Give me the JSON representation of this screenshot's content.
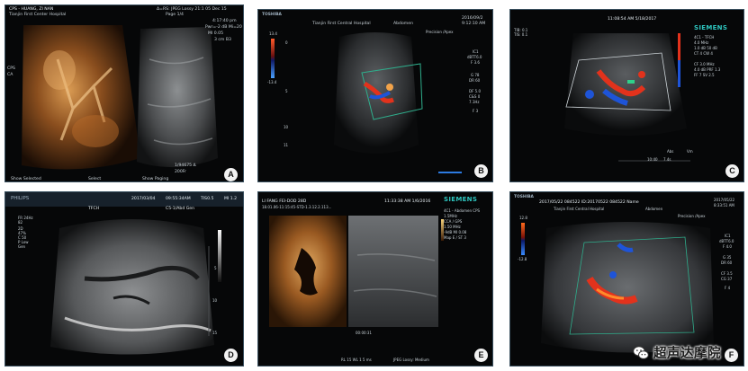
{
  "panels": {
    "A": {
      "letter": "A",
      "header": [
        "CPS - HUANG, ZI NAN",
        "Tianjin  First  Center  Hospital"
      ],
      "header_right": [
        "Δ=RS: JPEG Lossy 21:1   05 Dec 15",
        "Page 1/4",
        "4:17:40 pm",
        "Pwr=-2 dB  Mi=20",
        "MI 0.05",
        "3 cm   B3"
      ],
      "side_left": [
        "CPS",
        "CA"
      ],
      "footer": [
        "1/94675 Δ",
        "200Fr",
        "Show Selected",
        "Select",
        "Show Paging"
      ]
    },
    "B": {
      "letter": "B",
      "brand": "TOSHIBA",
      "header": [
        "Tianjin First Central Hospital",
        "Abdomen"
      ],
      "header_right": [
        "2016/09/2",
        "9:12:10 AM"
      ],
      "labels_right": [
        "Precision  /Apex",
        "IC1",
        "dBTT6.0",
        "F 3.6",
        "G 78",
        "DR 60",
        "DF 5.0",
        "C&S 0",
        "7.1Hz",
        "F 3"
      ],
      "scale_left": [
        "13.4",
        "-13.4"
      ],
      "depth_ticks": [
        "0",
        "5",
        "10",
        "11"
      ]
    },
    "C": {
      "letter": "C",
      "header": "11:08:54 AM 5/18/2017",
      "header_left": [
        "TIB: 0.1",
        "TIS: 0.1"
      ],
      "brand": "SIEMENS",
      "labels_right": [
        "4C1 - TFCH",
        "4.0 MHz",
        "1.0 dB  50 dB",
        "CT 4 CW 4",
        "CF 3.0 MHz",
        "4.0 dB  PRF 1.3",
        "FF 7 SV 2.5"
      ],
      "footer": [
        "Abs",
        "Vm",
        "10:40",
        "7.4s"
      ]
    },
    "D": {
      "letter": "D",
      "brand": "PHILIPS",
      "header": [
        "2017/03/04",
        "09:55:34AM",
        "TIS0.5",
        "MI 1.2"
      ],
      "subheader": [
        "TFCH",
        "C5-1/Abd Gen"
      ],
      "labels_left": [
        "FR 24Hz",
        "82",
        "2D",
        "47%",
        "C 50",
        "P Low",
        "Gen"
      ],
      "depth_ticks": [
        "5",
        "10",
        "15"
      ]
    },
    "E": {
      "letter": "E",
      "header": [
        "LI FANG FEI-DOD 28D",
        "11:33:38 AM 1/6/2016"
      ],
      "subheader": [
        "18.01.06-11:15:45-STD-1.3.12.2.113...",
        "",
        ""
      ],
      "brand": "SIEMENS",
      "labels_right": [
        "4C1 - Abdomen CPS",
        "1.5MHz",
        "CCA / GPS",
        "1.50 MHz",
        "-9dB  MI 0.08",
        "Map E / ST 3"
      ],
      "footer": [
        "RL 15 WL 1   5 ms",
        "JPEG Lossy: Medium",
        "00:00:31"
      ]
    },
    "F": {
      "letter": "F",
      "brand": "TOSHIBA",
      "header": "2017/05/22 084522 ID:20170522 084522 Name",
      "subheader": [
        "Tianjin First Central Hospital",
        "Abdomen"
      ],
      "header_right": [
        "2017/05/22",
        "8:33:51 AM"
      ],
      "labels_right": [
        "Precision  /Apex",
        "IC1",
        "dBTT6.0",
        "F 4.0",
        "G 35",
        "DR 60",
        "CF 3.5",
        "CG 37",
        "F 4"
      ],
      "scale_left": [
        "12.8",
        "-12.8"
      ]
    }
  },
  "watermark": {
    "text": "超声达摩院",
    "icon": "wechat-icon"
  },
  "colors": {
    "doppler_red": "#e2321c",
    "doppler_blue": "#1e54d8",
    "siemens_teal": "#2ec6c0",
    "contrast_orange": "#c47a2e"
  }
}
